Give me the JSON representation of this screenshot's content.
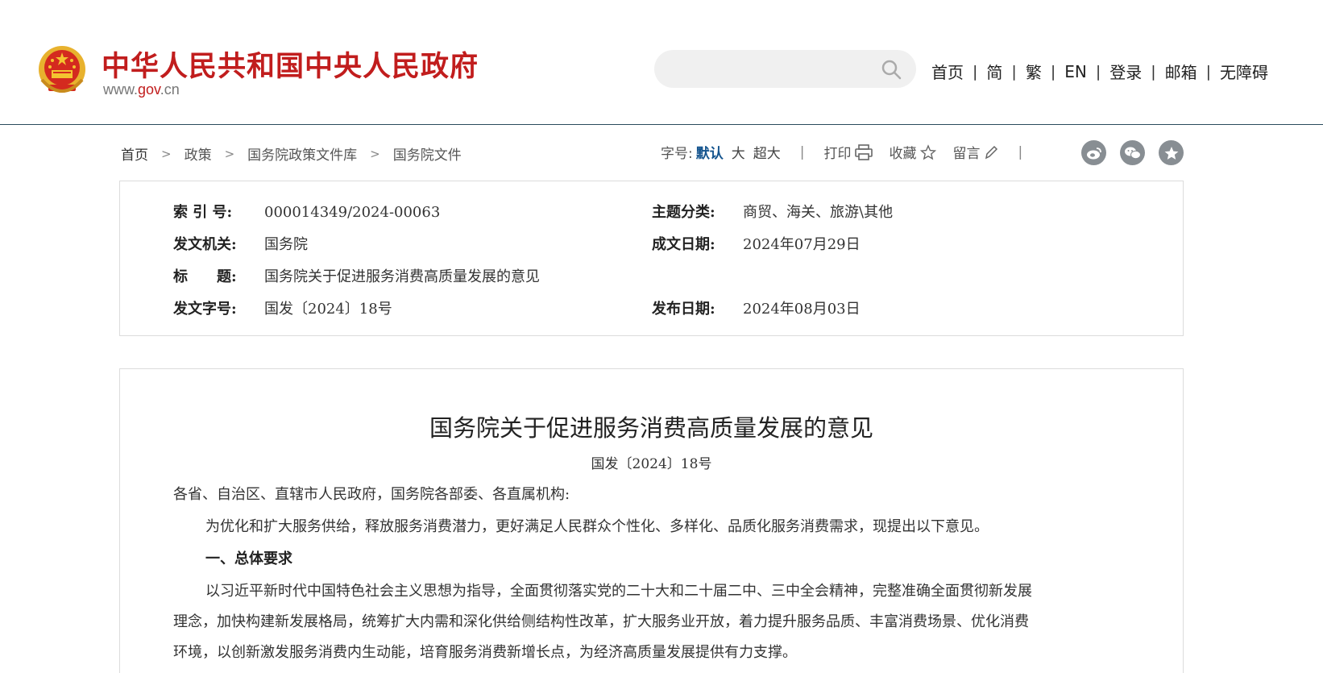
{
  "header": {
    "site_name": "中华人民共和国中央人民政府",
    "site_url_prefix": "www.",
    "site_url_mid": "gov",
    "site_url_suffix": ".cn",
    "search": {
      "placeholder": "",
      "value": ""
    },
    "nav": [
      "首页",
      "简",
      "繁",
      "EN",
      "登录",
      "邮箱",
      "无障碍"
    ],
    "brand_color": "#c11d1d",
    "emblem_icon": "national-emblem-icon"
  },
  "breadcrumb": [
    "首页",
    "政策",
    "国务院政策文件库",
    "国务院文件"
  ],
  "tools": {
    "font_label": "字号:",
    "font_sizes": [
      "默认",
      "大",
      "超大"
    ],
    "active_font_size": "默认",
    "print": "打印",
    "favorite": "收藏",
    "comment": "留言",
    "share_icons": [
      "weibo-icon",
      "wechat-icon",
      "star-share-icon"
    ]
  },
  "meta": {
    "index_label": "索 引 号:",
    "index_value": "000014349/2024-00063",
    "topic_label": "主题分类:",
    "topic_value": "商贸、海关、旅游\\其他",
    "issuer_label": "发文机关:",
    "issuer_value": "国务院",
    "written_label": "成文日期:",
    "written_value": "2024年07月29日",
    "title_label": "标　　题:",
    "title_value": "国务院关于促进服务消费高质量发展的意见",
    "docno_label": "发文字号:",
    "docno_value": "国发〔2024〕18号",
    "published_label": "发布日期:",
    "published_value": "2024年08月03日"
  },
  "document": {
    "title": "国务院关于促进服务消费高质量发展的意见",
    "doc_number": "国发〔2024〕18号",
    "salutation": "各省、自治区、直辖市人民政府，国务院各部委、各直属机构:",
    "intro": "为优化和扩大服务供给，释放服务消费潜力，更好满足人民群众个性化、多样化、品质化服务消费需求，现提出以下意见。",
    "section1_heading": "一、总体要求",
    "section1_line1": "以习近平新时代中国特色社会主义思想为指导，全面贯彻落实党的二十大和二十届二中、三中全会精神，完整准确全面贯彻新发展",
    "section1_line2": "理念，加快构建新发展格局，统筹扩大内需和深化供给侧结构性改革，扩大服务业开放，着力提升服务品质、丰富消费场景、优化消费",
    "section1_line3": "环境，以创新激发服务消费内生动能，培育服务消费新增长点，为经济高质量发展提供有力支撑。"
  }
}
